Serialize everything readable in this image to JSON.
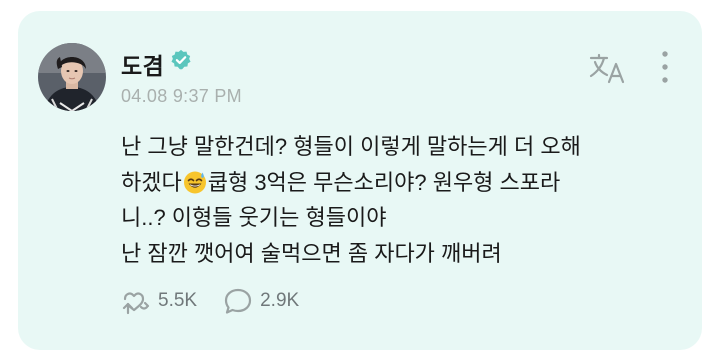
{
  "post": {
    "author": "도겸",
    "timestamp": "04.08 9:37 PM",
    "text_lines": [
      "난 그냥 말한건데? 형들이 이렇게 말하는게 더 오해",
      [
        "하겠다",
        "쿱형 3억은 무슨소리야? 원우형 스포라"
      ],
      "니..? 이형들 웃기는 형들이야",
      "난 잠깐 깻어여 술먹으면 좀 자다가 깨버려"
    ],
    "likes": "5.5K",
    "comments": "2.9K"
  },
  "colors": {
    "card_bg": "#e8f8f5",
    "verified": "#5bc6bd",
    "timestamp": "#a9b0ae",
    "icons": "#9aa3a3"
  },
  "icons": {
    "verified": "verified-badge-icon",
    "translate": "translate-icon",
    "more": "more-vertical-icon",
    "like": "like-icon",
    "comment": "comment-icon",
    "emoji": "sweat-smile-emoji"
  }
}
